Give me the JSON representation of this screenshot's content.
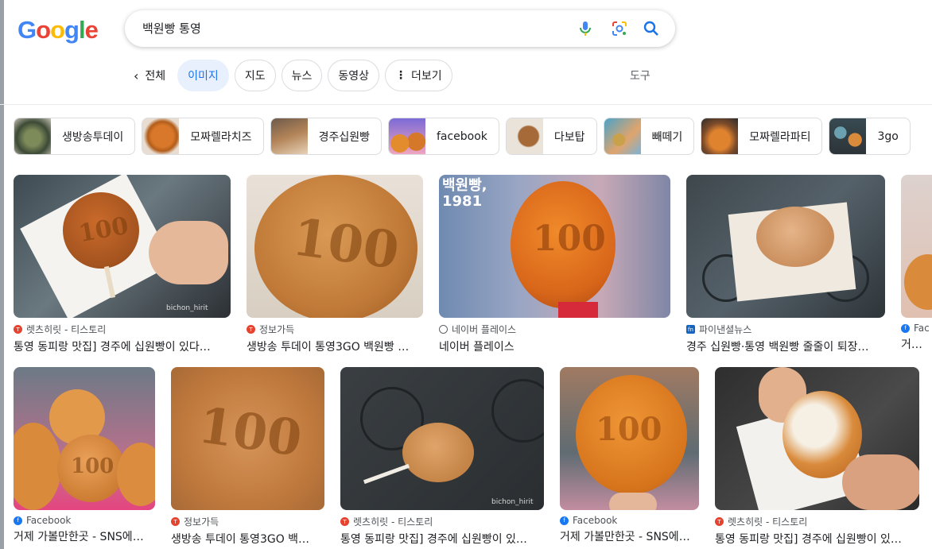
{
  "logo": {
    "letters": [
      "G",
      "o",
      "o",
      "g",
      "l",
      "e"
    ],
    "colors": [
      "#4285F4",
      "#EA4335",
      "#FBBC05",
      "#4285F4",
      "#34A853",
      "#EA4335"
    ]
  },
  "search": {
    "query": "백원빵 통영"
  },
  "tabs": {
    "back": "전체",
    "items": [
      "이미지",
      "지도",
      "뉴스",
      "동영상"
    ],
    "more": "더보기",
    "tools": "도구",
    "active_color": "#1a73e8"
  },
  "chips": [
    "생방송투데이",
    "모짜렐라치즈",
    "경주십원빵",
    "facebook",
    "다보탑",
    "빼떼기",
    "모짜렐라파티",
    "3go"
  ],
  "row1": [
    {
      "source": "렛츠히릿 - 티스토리",
      "title": "통영 동피랑 맛집] 경주에 십원빵이 있다…",
      "coin": "100",
      "watermark": "bichon_hirit"
    },
    {
      "source": "정보가득",
      "title": "생방송 투데이 통영3GO 백원빵 …",
      "coin": "100"
    },
    {
      "source": "네이버 플레이스",
      "title": "네이버 플레이스",
      "coin": "100",
      "overlay": "백원빵,\n1981"
    },
    {
      "source": "파이낸셜뉴스",
      "title": "경주 십원빵·통영 백원빵 줄줄이 퇴장…",
      "coin": ""
    },
    {
      "source": "Fac",
      "title": "거제 가"
    }
  ],
  "row2": [
    {
      "source": "Facebook",
      "title": "거제 가볼만한곳 - SNS에…",
      "coin": "100"
    },
    {
      "source": "정보가득",
      "title": "생방송 투데이 통영3GO 백…",
      "coin": "100"
    },
    {
      "source": "렛츠히릿 - 티스토리",
      "title": "통영 동피랑 맛집] 경주에 십원빵이 있…",
      "coin": "",
      "watermark": "bichon_hirit"
    },
    {
      "source": "Facebook",
      "title": "거제 가볼만한곳 - SNS에…",
      "coin": "100"
    },
    {
      "source": "렛츠히릿 - 티스토리",
      "title": "통영 동피랑 맛집] 경주에 십원빵이 있…",
      "coin": ""
    }
  ]
}
